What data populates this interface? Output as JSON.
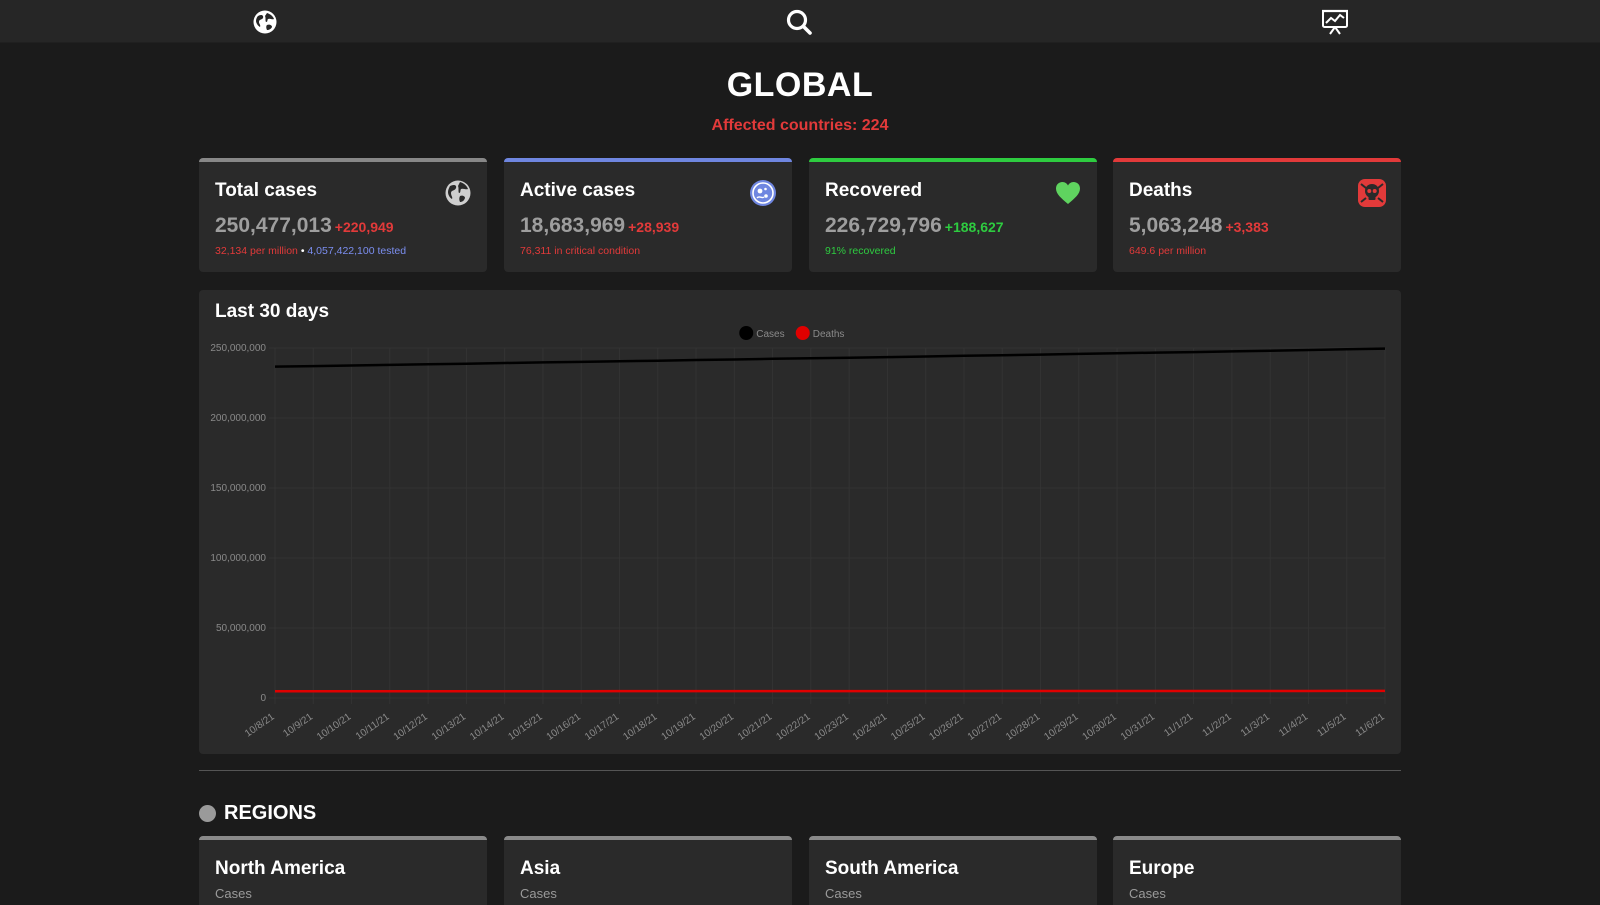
{
  "nav": {
    "icons": [
      "globe-icon",
      "search-icon",
      "chart-presentation-icon"
    ]
  },
  "header": {
    "title": "GLOBAL",
    "affected_label": "Affected countries: 224"
  },
  "stats": [
    {
      "title": "Total cases",
      "value": "250,477,013",
      "delta": "+220,949",
      "note_a": "32,134 per million",
      "note_sep": "•",
      "note_b": "4,057,422,100 tested",
      "icon": "globe-icon",
      "accent": "#8a8a8a",
      "delta_color": "#e23a3a",
      "note_color": "#e23a3a",
      "note_b_color": "#7b8ef0"
    },
    {
      "title": "Active cases",
      "value": "18,683,969",
      "delta": "+28,939",
      "note_a": "76,311 in critical condition",
      "icon": "virus-icon",
      "accent": "#6f86e0",
      "delta_color": "#e23a3a",
      "note_color": "#e23a3a"
    },
    {
      "title": "Recovered",
      "value": "226,729,796",
      "delta": "+188,627",
      "note_a": "91% recovered",
      "icon": "heart-icon",
      "accent": "#2ecc40",
      "delta_color": "#2ecc40",
      "note_color": "#2ecc40"
    },
    {
      "title": "Deaths",
      "value": "5,063,248",
      "delta": "+3,383",
      "note_a": "649.6 per million",
      "icon": "skull-icon",
      "accent": "#e23a3a",
      "delta_color": "#e23a3a",
      "note_color": "#e23a3a"
    }
  ],
  "chart_data": {
    "type": "line",
    "title": "Last 30 days",
    "legend_position": "top-center",
    "grid": true,
    "ylim": [
      0,
      250000000
    ],
    "y_ticks": [
      "250,000,000",
      "200,000,000",
      "150,000,000",
      "100,000,000",
      "50,000,000",
      "0"
    ],
    "x": [
      "10/8/21",
      "10/9/21",
      "10/10/21",
      "10/11/21",
      "10/12/21",
      "10/13/21",
      "10/14/21",
      "10/15/21",
      "10/16/21",
      "10/17/21",
      "10/18/21",
      "10/19/21",
      "10/20/21",
      "10/21/21",
      "10/22/21",
      "10/23/21",
      "10/24/21",
      "10/25/21",
      "10/26/21",
      "10/27/21",
      "10/28/21",
      "10/29/21",
      "10/30/21",
      "10/31/21",
      "11/1/21",
      "11/2/21",
      "11/3/21",
      "11/4/21",
      "11/5/21",
      "11/6/21"
    ],
    "series": [
      {
        "name": "Cases",
        "color": "#000000",
        "values": [
          236700000,
          237100000,
          237500000,
          237900000,
          238400000,
          238800000,
          239300000,
          239700000,
          240100000,
          240500000,
          240900000,
          241400000,
          241800000,
          242300000,
          242700000,
          243100000,
          243500000,
          243900000,
          244400000,
          244800000,
          245300000,
          245800000,
          246200000,
          246700000,
          247100000,
          247600000,
          248100000,
          248600000,
          249100000,
          249600000
        ]
      },
      {
        "name": "Deaths",
        "color": "#e00000",
        "values": [
          4830000,
          4838000,
          4845000,
          4852000,
          4860000,
          4868000,
          4876000,
          4883000,
          4890000,
          4897000,
          4904000,
          4912000,
          4920000,
          4927000,
          4934000,
          4941000,
          4948000,
          4956000,
          4964000,
          4971000,
          4978000,
          4986000,
          4993000,
          5001000,
          5009000,
          5017000,
          5025000,
          5033000,
          5041000,
          5049000
        ]
      }
    ]
  },
  "regions": {
    "title": "REGIONS",
    "items": [
      {
        "name": "North America",
        "sub": "Cases"
      },
      {
        "name": "Asia",
        "sub": "Cases"
      },
      {
        "name": "South America",
        "sub": "Cases"
      },
      {
        "name": "Europe",
        "sub": "Cases"
      }
    ]
  }
}
